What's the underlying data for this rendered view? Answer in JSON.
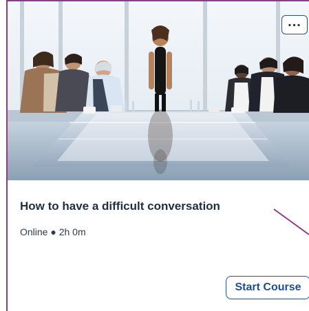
{
  "course": {
    "title": "How to have a difficult conversation",
    "meta": "Online ● 2h 0m",
    "more_label": "...",
    "start_label": "Start Course"
  },
  "hero": {
    "description": "business meeting image"
  },
  "colors": {
    "accent": "#1f4e8c",
    "border": "#8c3c86",
    "title": "#1f2f40",
    "meta": "#2e3b4a"
  },
  "icons": {
    "more": "more-icon",
    "pointer": "arrow-annotation-icon"
  }
}
